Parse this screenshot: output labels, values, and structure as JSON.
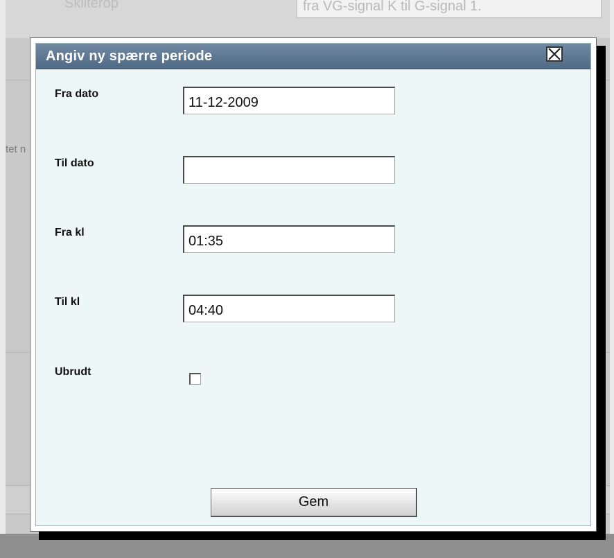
{
  "background": {
    "top_label": "Skilterop",
    "top_field_value": "fra VG-signal K til G-signal 1.",
    "cut_text": "tet n"
  },
  "dialog": {
    "title": "Angiv ny spærre periode",
    "close_icon": "close-x-icon",
    "fields": {
      "fra_dato": {
        "label": "Fra dato",
        "value": "11-12-2009"
      },
      "til_dato": {
        "label": "Til dato",
        "value": ""
      },
      "fra_kl": {
        "label": "Fra kl",
        "value": "01:35"
      },
      "til_kl": {
        "label": "Til kl",
        "value": "04:40"
      },
      "ubrudt": {
        "label": "Ubrudt",
        "checked": false
      }
    },
    "save_label": "Gem"
  },
  "colors": {
    "titlebar": "#5f7893",
    "dialog_body": "#eef7f7"
  }
}
